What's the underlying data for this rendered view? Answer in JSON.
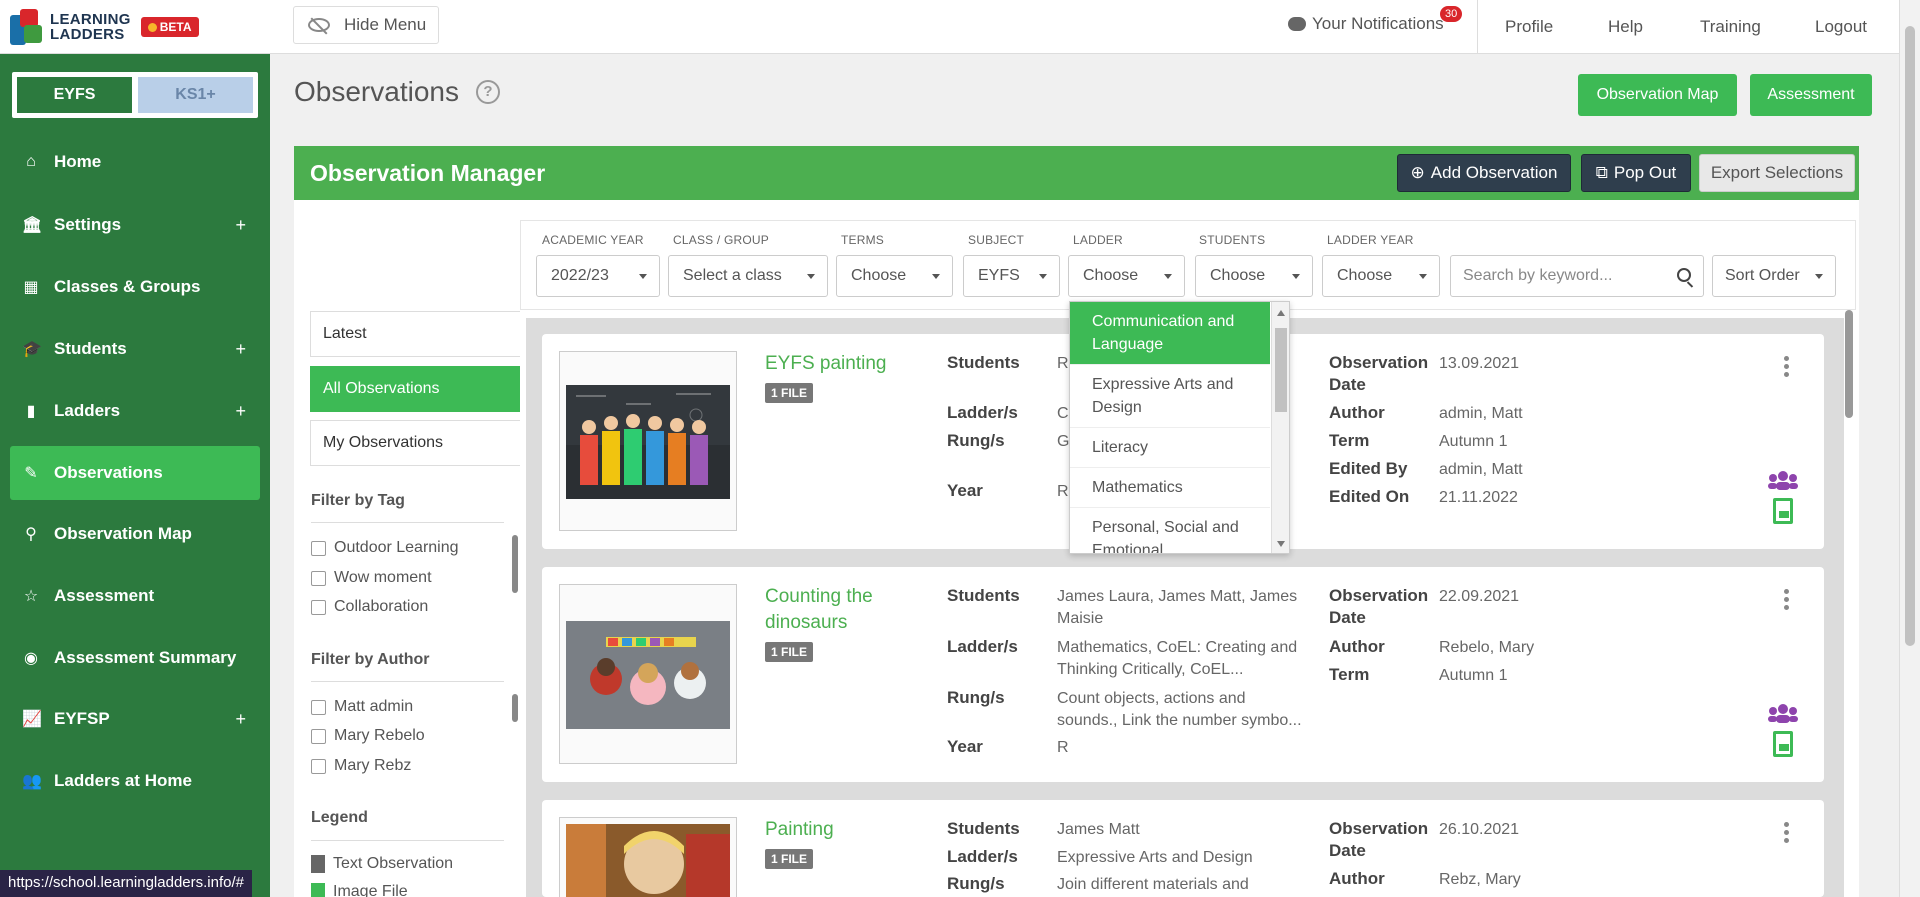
{
  "header": {
    "logo_line1": "LEARNING",
    "logo_line2": "LADDERS",
    "beta": "BETA",
    "hide_menu": "Hide Menu",
    "notifications": "Your Notifications",
    "notification_count": "30",
    "nav": [
      "Profile",
      "Help",
      "Training",
      "Logout"
    ]
  },
  "sidebar": {
    "stages": [
      "EYFS",
      "KS1+"
    ],
    "items": [
      {
        "label": "Home",
        "icon": "home-icon",
        "plus": false
      },
      {
        "label": "Settings",
        "icon": "bank-icon",
        "plus": true
      },
      {
        "label": "Classes & Groups",
        "icon": "grid-icon",
        "plus": false
      },
      {
        "label": "Students",
        "icon": "graduation-cap-icon",
        "plus": true
      },
      {
        "label": "Ladders",
        "icon": "book-icon",
        "plus": true
      },
      {
        "label": "Observations",
        "icon": "pencil-icon",
        "plus": false,
        "active": true
      },
      {
        "label": "Observation Map",
        "icon": "map-marker-icon",
        "plus": false
      },
      {
        "label": "Assessment",
        "icon": "star-icon",
        "plus": false
      },
      {
        "label": "Assessment Summary",
        "icon": "eye-icon",
        "plus": false
      },
      {
        "label": "EYFSP",
        "icon": "line-chart-icon",
        "plus": true
      },
      {
        "label": "Ladders at Home",
        "icon": "users-icon",
        "plus": false
      }
    ]
  },
  "page": {
    "title": "Observations",
    "help": "?",
    "observation_map_btn": "Observation Map",
    "assessment_btn": "Assessment"
  },
  "manager": {
    "title": "Observation Manager",
    "add_btn": "Add Observation",
    "popout_btn": "Pop Out",
    "export_btn": "Export Selections"
  },
  "filters": {
    "labels": [
      "ACADEMIC YEAR",
      "CLASS / GROUP",
      "TERMS",
      "SUBJECT",
      "LADDER",
      "STUDENTS",
      "LADDER YEAR"
    ],
    "values": [
      "2022/23",
      "Select a class",
      "Choose",
      "EYFS",
      "Choose",
      "Choose",
      "Choose"
    ],
    "search_placeholder": "Search by keyword...",
    "sort": "Sort Order"
  },
  "ladder_dropdown": [
    "Communication and Language",
    "Expressive Arts and Design",
    "Literacy",
    "Mathematics",
    "Personal, Social and Emotional Development"
  ],
  "left_panel": {
    "views": [
      "Latest",
      "All Observations",
      "My Observations"
    ],
    "tag_title": "Filter by Tag",
    "tags": [
      "Outdoor Learning",
      "Wow moment",
      "Collaboration"
    ],
    "author_title": "Filter by Author",
    "authors": [
      "Matt admin",
      "Mary Rebelo",
      "Mary Rebz"
    ],
    "legend_title": "Legend",
    "legend": [
      "Text Observation",
      "Image File"
    ]
  },
  "field_labels": {
    "students": "Students",
    "ladders": "Ladder/s",
    "rungs": "Rung/s",
    "year": "Year",
    "obs_date_1": "Observation",
    "obs_date_2": "Date",
    "author": "Author",
    "term": "Term",
    "edited_by": "Edited By",
    "edited_on": "Edited On"
  },
  "observations": [
    {
      "title": "EYFS painting",
      "files": "1 FILE",
      "students": "Ra… Ja…",
      "ladders": "Co…",
      "rungs": "Ga… ex…",
      "year": "R",
      "date": "13.09.2021",
      "author": "admin, Matt",
      "term": "Autumn 1",
      "edited_by": "admin, Matt",
      "edited_on": "21.11.2022"
    },
    {
      "title_line1": "Counting the",
      "title_line2": "dinosaurs",
      "files": "1 FILE",
      "students_line1": "James Laura, James Matt, James",
      "students_line2": "Maisie",
      "ladders_line1": "Mathematics, CoEL: Creating and",
      "ladders_line2": "Thinking Critically, CoEL...",
      "rungs_line1": "Count objects, actions and",
      "rungs_line2": "sounds., Link the number symbo...",
      "year": "R",
      "date": "22.09.2021",
      "author": "Rebelo, Mary",
      "term": "Autumn 1"
    },
    {
      "title": "Painting",
      "files": "1 FILE",
      "students": "James Matt",
      "ladders": "Expressive Arts and Design",
      "rungs": "Join different materials and",
      "date": "26.10.2021",
      "author": "Rebz, Mary"
    }
  ],
  "status_url": "https://school.learningladders.info/#"
}
